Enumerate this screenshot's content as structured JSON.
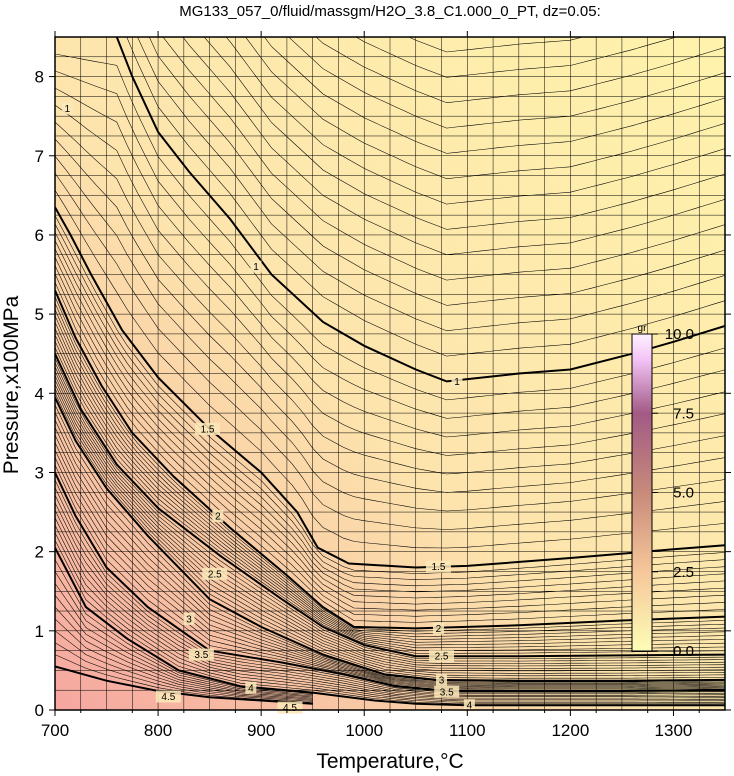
{
  "chart_data": {
    "type": "contour",
    "title": "MG133_057_0/fluid/massgm/H2O_3.8_C1.000_0_PT, dz=0.05:",
    "xlabel": "Temperature,°C",
    "ylabel": "Pressure,x100MPa",
    "xlim": [
      700,
      1350
    ],
    "ylim": [
      0,
      8.5
    ],
    "x_ticks": [
      "700",
      "800",
      "900",
      "1000",
      "1100",
      "1200",
      "1300"
    ],
    "y_ticks": [
      "0",
      "1",
      "2",
      "3",
      "4",
      "5",
      "6",
      "7",
      "8"
    ],
    "grid": true,
    "contour_interval": 0.05,
    "labeled_contours": [
      {
        "level": "1",
        "points": [
          [
            760,
            8.5
          ],
          [
            775,
            8.0
          ],
          [
            800,
            7.3
          ],
          [
            830,
            6.8
          ],
          [
            870,
            6.2
          ],
          [
            910,
            5.5
          ],
          [
            960,
            4.9
          ],
          [
            1000,
            4.6
          ],
          [
            1050,
            4.3
          ],
          [
            1080,
            4.15
          ],
          [
            1150,
            4.25
          ],
          [
            1200,
            4.3
          ],
          [
            1260,
            4.5
          ],
          [
            1300,
            4.65
          ],
          [
            1350,
            4.85
          ]
        ]
      },
      {
        "level": "1.5",
        "points": [
          [
            700,
            6.35
          ],
          [
            715,
            6.0
          ],
          [
            735,
            5.5
          ],
          [
            765,
            4.8
          ],
          [
            800,
            4.2
          ],
          [
            850,
            3.55
          ],
          [
            900,
            3.0
          ],
          [
            935,
            2.5
          ],
          [
            955,
            2.05
          ],
          [
            985,
            1.85
          ],
          [
            1050,
            1.8
          ],
          [
            1100,
            1.82
          ],
          [
            1200,
            1.92
          ],
          [
            1300,
            2.03
          ],
          [
            1350,
            2.08
          ]
        ]
      },
      {
        "level": "2",
        "points": [
          [
            700,
            5.3
          ],
          [
            720,
            4.7
          ],
          [
            745,
            4.1
          ],
          [
            775,
            3.5
          ],
          [
            815,
            2.95
          ],
          [
            870,
            2.3
          ],
          [
            925,
            1.7
          ],
          [
            960,
            1.3
          ],
          [
            990,
            1.05
          ],
          [
            1050,
            1.03
          ],
          [
            1150,
            1.07
          ],
          [
            1250,
            1.13
          ],
          [
            1350,
            1.18
          ]
        ]
      },
      {
        "level": "2.5",
        "points": [
          [
            700,
            4.5
          ],
          [
            725,
            3.8
          ],
          [
            760,
            3.1
          ],
          [
            800,
            2.55
          ],
          [
            860,
            1.95
          ],
          [
            920,
            1.4
          ],
          [
            960,
            1.05
          ],
          [
            1000,
            0.82
          ],
          [
            1050,
            0.68
          ],
          [
            1150,
            0.68
          ],
          [
            1250,
            0.69
          ],
          [
            1350,
            0.7
          ]
        ]
      },
      {
        "level": "3",
        "points": [
          [
            700,
            3.95
          ],
          [
            720,
            3.4
          ],
          [
            750,
            2.8
          ],
          [
            790,
            2.2
          ],
          [
            850,
            1.4
          ],
          [
            900,
            1.05
          ],
          [
            960,
            0.7
          ],
          [
            1020,
            0.45
          ],
          [
            1070,
            0.38
          ],
          [
            1150,
            0.37
          ],
          [
            1250,
            0.37
          ],
          [
            1350,
            0.38
          ]
        ]
      },
      {
        "level": "3.5",
        "points": [
          [
            700,
            3.0
          ],
          [
            720,
            2.45
          ],
          [
            750,
            1.8
          ],
          [
            790,
            1.3
          ],
          [
            850,
            0.75
          ],
          [
            920,
            0.6
          ],
          [
            980,
            0.45
          ],
          [
            1030,
            0.3
          ],
          [
            1080,
            0.24
          ],
          [
            1150,
            0.24
          ],
          [
            1250,
            0.24
          ],
          [
            1350,
            0.25
          ]
        ]
      },
      {
        "level": "4",
        "points": [
          [
            700,
            2.05
          ],
          [
            730,
            1.3
          ],
          [
            770,
            0.9
          ],
          [
            820,
            0.5
          ],
          [
            880,
            0.3
          ],
          [
            950,
            0.22
          ],
          [
            1010,
            0.12
          ],
          [
            1050,
            0.08
          ],
          [
            1100,
            0.06
          ],
          [
            1200,
            0.06
          ],
          [
            1350,
            0.06
          ]
        ]
      },
      {
        "level": "4.5",
        "points": [
          [
            700,
            0.55
          ],
          [
            750,
            0.37
          ],
          [
            800,
            0.24
          ],
          [
            850,
            0.16
          ],
          [
            900,
            0.12
          ],
          [
            950,
            0.08
          ]
        ]
      }
    ],
    "contour_label_positions": [
      {
        "text": "1",
        "x": 895,
        "y": 5.6
      },
      {
        "text": "1",
        "x": 1090,
        "y": 4.15
      },
      {
        "text": "1",
        "x": 712,
        "y": 7.6
      },
      {
        "text": "1.5",
        "x": 848,
        "y": 3.55
      },
      {
        "text": "1.5",
        "x": 1072,
        "y": 1.81
      },
      {
        "text": "2",
        "x": 858,
        "y": 2.45
      },
      {
        "text": "2",
        "x": 1072,
        "y": 1.03
      },
      {
        "text": "2.5",
        "x": 855,
        "y": 1.72
      },
      {
        "text": "2.5",
        "x": 1075,
        "y": 0.68
      },
      {
        "text": "3",
        "x": 830,
        "y": 1.15
      },
      {
        "text": "3",
        "x": 1075,
        "y": 0.38
      },
      {
        "text": "3.5",
        "x": 842,
        "y": 0.7
      },
      {
        "text": "3.5",
        "x": 1080,
        "y": 0.23
      },
      {
        "text": "4",
        "x": 890,
        "y": 0.28
      },
      {
        "text": "4",
        "x": 1102,
        "y": 0.06
      },
      {
        "text": "4.5",
        "x": 810,
        "y": 0.17
      },
      {
        "text": "4.5",
        "x": 928,
        "y": 0.03
      }
    ],
    "colorbar": {
      "unit": "gr",
      "ticks": [
        "0.0",
        "2.5",
        "5.0",
        "7.5",
        "10.0"
      ],
      "range": [
        0,
        10
      ],
      "colors": [
        "#fdfdb6",
        "#f6c79a",
        "#c88a7a",
        "#a25a85",
        "#f3c4f7",
        "#fff2ff"
      ]
    },
    "background_colors": {
      "low_value": "#fef0a8",
      "high_value": "#f6a6a0"
    },
    "line_color": "#000000"
  }
}
